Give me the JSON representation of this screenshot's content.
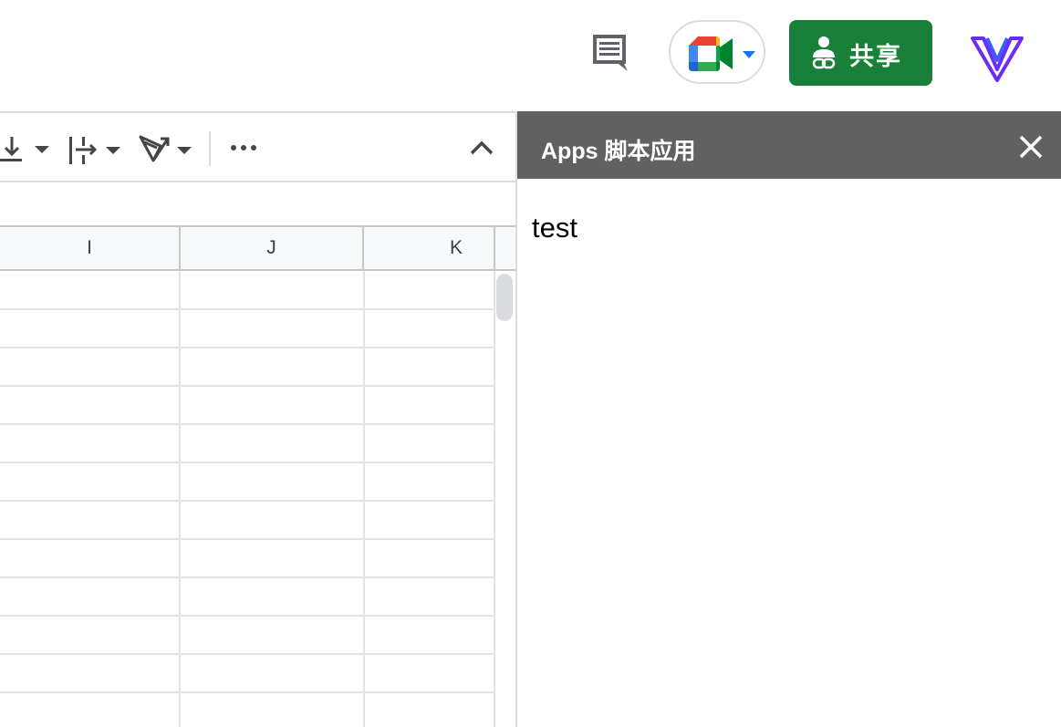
{
  "header": {
    "share_label": "共享",
    "icons": [
      "comment-icon",
      "google-meet-icon",
      "share-person-link-icon",
      "app-logo-icon"
    ]
  },
  "toolbar": {
    "icons": [
      "vertical-align-bottom-icon",
      "text-wrap-icon",
      "text-rotation-icon",
      "more-icon",
      "collapse-chevron-icon"
    ]
  },
  "sheet": {
    "columns": [
      "I",
      "J",
      "K"
    ]
  },
  "side_panel": {
    "title": "Apps 脚本应用",
    "content": "test"
  },
  "colors": {
    "share_green": "#188038",
    "panel_header": "#616161",
    "logo_purple": "#6b2cf5"
  }
}
